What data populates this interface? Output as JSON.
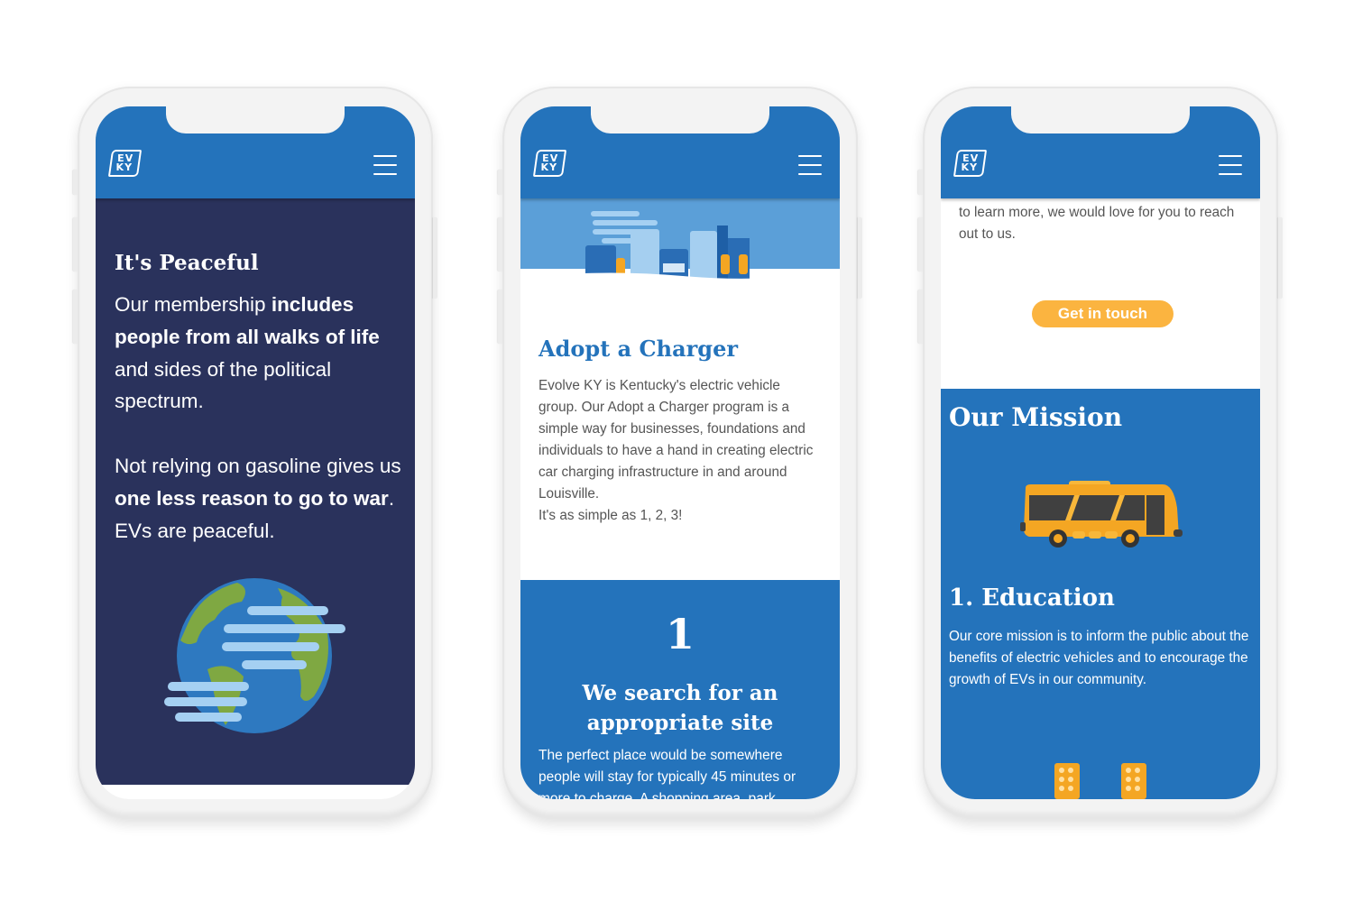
{
  "brand": {
    "logo_line1": "EV",
    "logo_line2": "KY",
    "primary_color": "#2473bb",
    "navy_color": "#2a325c",
    "accent_color": "#fbb440"
  },
  "phones": [
    {
      "section_title": "It's Peaceful",
      "para1": {
        "t1": "Our membership ",
        "b1": "includes people from all walks of life",
        "t2": " and sides of the political spectrum."
      },
      "para2": {
        "t1": "Not relying on gasoline gives us ",
        "b1": "one less reason to go to war",
        "t2": ". EVs are peaceful."
      },
      "illustration": "earth-icon"
    },
    {
      "illustration": "city-chargers-icon",
      "heading": "Adopt a Charger",
      "body_lines": [
        "Evolve KY is Kentucky's electric vehicle group.  Our Adopt a Charger program is a simple way for businesses, foundations and individuals to have a hand in creating electric car charging infrastructure in and around Louisville.",
        "It's as simple as 1, 2, 3!"
      ],
      "step_number": "1",
      "step_title": "We search for an appropriate site",
      "step_body": "The perfect place would be somewhere people will stay for typically 45 minutes or more to charge. A shopping area, park"
    },
    {
      "intro_text": "to learn more, we would love for you to reach out to us.",
      "cta_label": "Get in touch",
      "mission_heading": "Our Mission",
      "illustration": "bus-icon",
      "item_heading": "1. Education",
      "item_body": "Our core mission is to inform the public about the benefits of electric vehicles and to encourage the growth of EVs in our community."
    }
  ]
}
